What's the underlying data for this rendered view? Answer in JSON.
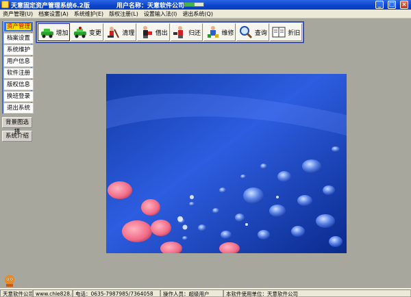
{
  "window": {
    "title": "天意固定资产管理系统6.2版",
    "user_label": "用户名称：天意软件公司",
    "progress_fraction": 0.55,
    "controls": [
      "_",
      "□",
      "×"
    ]
  },
  "menubar": {
    "items": [
      "资产管理(U)",
      "档案设置(A)",
      "系统维护(E)",
      "版权注册(L)",
      "设置输入法(I)",
      "退出系统(Q)"
    ]
  },
  "leftnav": {
    "items": [
      "资产管理",
      "档案设置",
      "系统维护",
      "用户信息",
      "软件注册",
      "版权信息",
      "换班登录",
      "退出系统"
    ],
    "extra": [
      "背景图选择",
      "系统介绍"
    ]
  },
  "toolbar": {
    "buttons": [
      {
        "label": "增加",
        "icon": "car-add-icon"
      },
      {
        "label": "变更",
        "icon": "car-change-icon"
      },
      {
        "label": "清理",
        "icon": "clean-icon"
      },
      {
        "label": "借出",
        "icon": "lend-icon"
      },
      {
        "label": "归还",
        "icon": "return-icon"
      },
      {
        "label": "维修",
        "icon": "repair-icon"
      },
      {
        "label": "查询",
        "icon": "magnifier-icon"
      },
      {
        "label": "折旧",
        "icon": "book-icon"
      }
    ]
  },
  "statusbar": {
    "company": "天意软件公司",
    "website": "www.chle828.com",
    "phone": "电话：0635-7987985/7364058",
    "operator": "操作人员：超级用户",
    "unit": "本软件使用单位：天意软件公司"
  },
  "colors": {
    "titlebar": "#0a43c8",
    "background": "#a8a79d",
    "accent": "#3a6fd8",
    "picture_blue": "#1d3fc4"
  }
}
